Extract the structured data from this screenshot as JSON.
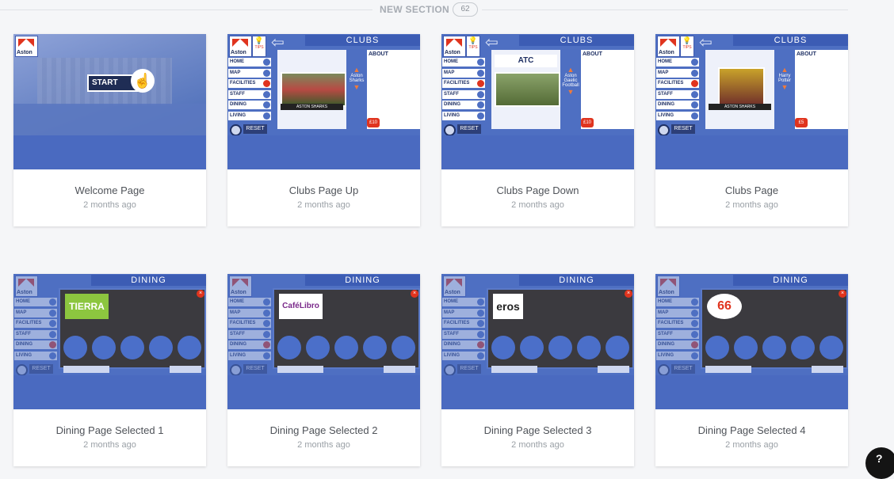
{
  "section": {
    "title": "NEW SECTION",
    "count": "62"
  },
  "cards": [
    {
      "title": "Welcome Page",
      "date": "2 months ago",
      "thumb": {
        "start": "START",
        "logo": "Aston"
      }
    },
    {
      "title": "Clubs Page Up",
      "date": "2 months ago",
      "thumb": {
        "banner": "CLUBS",
        "about": "ABOUT",
        "club": "Aston Sharks",
        "caption": "ASTON SHARKS",
        "price": "£10"
      }
    },
    {
      "title": "Clubs Page Down",
      "date": "2 months ago",
      "thumb": {
        "banner": "CLUBS",
        "about": "ABOUT",
        "club": "Aston Gaelic Football",
        "caption": "ATC",
        "price": "£10"
      }
    },
    {
      "title": "Clubs Page",
      "date": "2 months ago",
      "thumb": {
        "banner": "CLUBS",
        "about": "ABOUT",
        "club": "Harry Potter",
        "caption": "ASTON SHARKS",
        "price": "£5"
      }
    },
    {
      "title": "Dining Page Selected 1",
      "date": "2 months ago",
      "thumb": {
        "banner": "DINING",
        "brand": "TIERRA"
      }
    },
    {
      "title": "Dining Page Selected 2",
      "date": "2 months ago",
      "thumb": {
        "banner": "DINING",
        "brand": "CaféLibro"
      }
    },
    {
      "title": "Dining Page Selected 3",
      "date": "2 months ago",
      "thumb": {
        "banner": "DINING",
        "brand": "eros"
      }
    },
    {
      "title": "Dining Page Selected 4",
      "date": "2 months ago",
      "thumb": {
        "banner": "DINING",
        "brand": "66"
      }
    }
  ],
  "menu": [
    "HOME",
    "MAP",
    "FACILITIES",
    "STAFF",
    "DINING",
    "LIVING"
  ],
  "reset": "RESET",
  "tips": "TIPS",
  "colors": {
    "accent": "#4e6fc2",
    "red": "#e0341e",
    "navy": "#1e2f63"
  }
}
